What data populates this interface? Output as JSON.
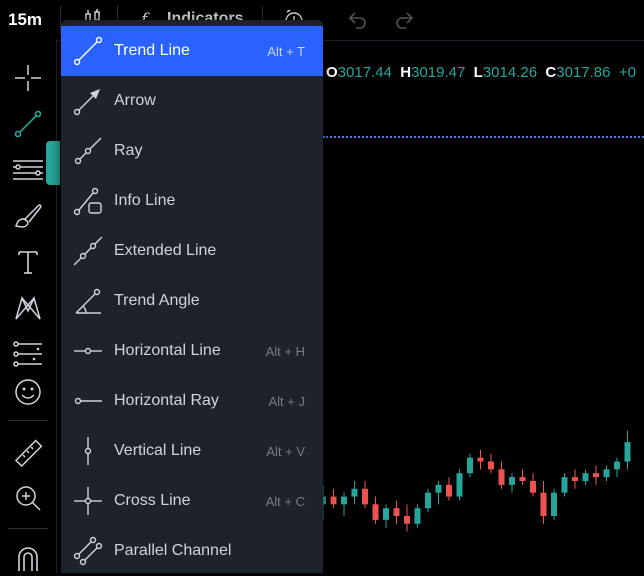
{
  "top_bar": {
    "interval": "15m",
    "indicators_label": "Indicators"
  },
  "ohlc": {
    "o_label": "O",
    "o_value": "3017.44",
    "h_label": "H",
    "h_value": "3019.47",
    "l_label": "L",
    "l_value": "3014.26",
    "c_label": "C",
    "c_value": "3017.86",
    "change": "+0"
  },
  "left_toolbar": {
    "tools": [
      "crosshair-icon",
      "trend-line-icon",
      "horizontal-lines-icon",
      "brush-icon",
      "text-icon",
      "patterns-icon",
      "prediction-icon",
      "emoji-icon",
      "ruler-icon",
      "zoom-in-icon",
      "magnet-icon"
    ]
  },
  "menu": {
    "items": [
      {
        "label": "Trend Line",
        "shortcut": "Alt + T",
        "icon": "trend-line-icon",
        "selected": true
      },
      {
        "label": "Arrow",
        "shortcut": "",
        "icon": "arrow-icon"
      },
      {
        "label": "Ray",
        "shortcut": "",
        "icon": "ray-icon"
      },
      {
        "label": "Info Line",
        "shortcut": "",
        "icon": "info-line-icon"
      },
      {
        "label": "Extended Line",
        "shortcut": "",
        "icon": "extended-line-icon"
      },
      {
        "label": "Trend Angle",
        "shortcut": "",
        "icon": "trend-angle-icon"
      },
      {
        "label": "Horizontal Line",
        "shortcut": "Alt + H",
        "icon": "horizontal-line-icon"
      },
      {
        "label": "Horizontal Ray",
        "shortcut": "Alt + J",
        "icon": "horizontal-ray-icon"
      },
      {
        "label": "Vertical Line",
        "shortcut": "Alt + V",
        "icon": "vertical-line-icon"
      },
      {
        "label": "Cross Line",
        "shortcut": "Alt + C",
        "icon": "cross-line-icon"
      },
      {
        "label": "Parallel Channel",
        "shortcut": "",
        "icon": "parallel-channel-icon"
      }
    ]
  },
  "colors": {
    "accent": "#2962ff",
    "up": "#26a69a",
    "down": "#ef5350",
    "menu_bg": "#1e222d"
  },
  "candles": [
    {
      "o": 3010,
      "h": 3012.5,
      "l": 3008,
      "c": 3011
    },
    {
      "o": 3011,
      "h": 3012,
      "l": 3009.5,
      "c": 3010
    },
    {
      "o": 3010,
      "h": 3011.5,
      "l": 3008.5,
      "c": 3011
    },
    {
      "o": 3011,
      "h": 3013,
      "l": 3010,
      "c": 3012
    },
    {
      "o": 3012,
      "h": 3013,
      "l": 3009.5,
      "c": 3010
    },
    {
      "o": 3010,
      "h": 3011,
      "l": 3007.5,
      "c": 3008
    },
    {
      "o": 3008,
      "h": 3010,
      "l": 3007,
      "c": 3009.5
    },
    {
      "o": 3009.5,
      "h": 3010.5,
      "l": 3007.5,
      "c": 3008.5
    },
    {
      "o": 3008.5,
      "h": 3010,
      "l": 3006.5,
      "c": 3007.5
    },
    {
      "o": 3007.5,
      "h": 3010,
      "l": 3007,
      "c": 3009.5
    },
    {
      "o": 3009.5,
      "h": 3012,
      "l": 3009,
      "c": 3011.5
    },
    {
      "o": 3011.5,
      "h": 3013,
      "l": 3010,
      "c": 3012.5
    },
    {
      "o": 3012.5,
      "h": 3013.5,
      "l": 3010.5,
      "c": 3011
    },
    {
      "o": 3011,
      "h": 3014.5,
      "l": 3010.5,
      "c": 3014
    },
    {
      "o": 3014,
      "h": 3016.5,
      "l": 3013.5,
      "c": 3016
    },
    {
      "o": 3016,
      "h": 3017,
      "l": 3014.5,
      "c": 3015.5
    },
    {
      "o": 3015.5,
      "h": 3016.5,
      "l": 3014,
      "c": 3014.5
    },
    {
      "o": 3014.5,
      "h": 3015.5,
      "l": 3012,
      "c": 3012.5
    },
    {
      "o": 3012.5,
      "h": 3014,
      "l": 3011.5,
      "c": 3013.5
    },
    {
      "o": 3013.5,
      "h": 3014.5,
      "l": 3012.5,
      "c": 3013
    },
    {
      "o": 3013,
      "h": 3014,
      "l": 3011,
      "c": 3011.5
    },
    {
      "o": 3011.5,
      "h": 3013,
      "l": 3007.5,
      "c": 3008.5
    },
    {
      "o": 3008.5,
      "h": 3012,
      "l": 3008,
      "c": 3011.5
    },
    {
      "o": 3011.5,
      "h": 3014,
      "l": 3011,
      "c": 3013.5
    },
    {
      "o": 3013.5,
      "h": 3014.5,
      "l": 3012,
      "c": 3013
    },
    {
      "o": 3013,
      "h": 3014.5,
      "l": 3012.5,
      "c": 3014
    },
    {
      "o": 3014,
      "h": 3015,
      "l": 3012.5,
      "c": 3013.5
    },
    {
      "o": 3013.5,
      "h": 3015,
      "l": 3013,
      "c": 3014.5
    },
    {
      "o": 3014.5,
      "h": 3016,
      "l": 3013.5,
      "c": 3015.5
    },
    {
      "o": 3015.5,
      "h": 3019.5,
      "l": 3014.5,
      "c": 3018
    }
  ]
}
